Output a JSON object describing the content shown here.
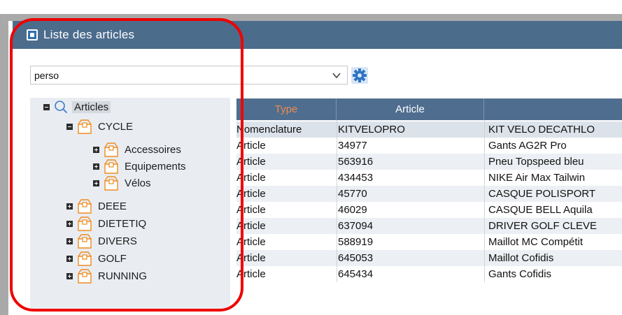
{
  "window": {
    "title": "Liste des articles"
  },
  "filter": {
    "value": "perso"
  },
  "icons": {
    "app": "app-icon",
    "chevron": "chevron-down-icon",
    "settings": "gear-icon",
    "search": "search-icon",
    "category": "box-icon"
  },
  "tree": {
    "root": "Articles",
    "cycle": "CYCLE",
    "accessoires": "Accessoires",
    "equipements": "Equipements",
    "velos": "Vélos",
    "deee": "DEEE",
    "dietetiq": "DIETETIQ",
    "divers": "DIVERS",
    "golf": "GOLF",
    "running": "RUNNING"
  },
  "grid": {
    "columns": [
      "Type",
      "Article",
      ""
    ],
    "rows": [
      [
        "Nomenclature",
        "KITVELOPRO",
        "KIT VELO DECATHLO"
      ],
      [
        "Article",
        "34977",
        "Gants AG2R Pro"
      ],
      [
        "Article",
        "563916",
        "Pneu Topspeed bleu"
      ],
      [
        "Article",
        "434453",
        "NIKE Air Max Tailwin"
      ],
      [
        "Article",
        "45770",
        "CASQUE POLISPORT"
      ],
      [
        "Article",
        "46029",
        "CASQUE BELL Aquila"
      ],
      [
        "Article",
        "637094",
        "DRIVER GOLF CLEVE"
      ],
      [
        "Article",
        "588919",
        "Maillot MC Compétit"
      ],
      [
        "Article",
        "645053",
        "Maillot Cofidis"
      ],
      [
        "Article",
        "645434",
        "Gants Cofidis"
      ]
    ]
  },
  "colors": {
    "titlebar": "#4c6c8c",
    "grid_header": "#4f6e8f",
    "type_header_text": "#ef8a4d",
    "annotation": "#ef0000",
    "tree_bg": "#e9edf2",
    "box_icon": "#f08c1f"
  }
}
